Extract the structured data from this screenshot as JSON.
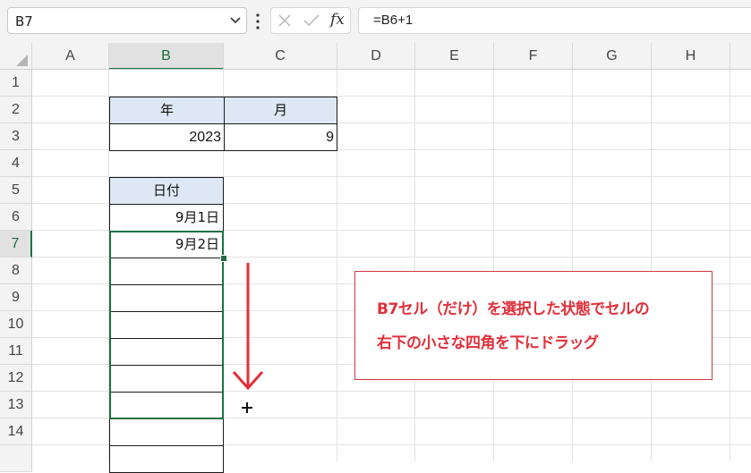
{
  "formula_bar": {
    "name_box": "B7",
    "fx_label": "fx",
    "formula": "=B6+1"
  },
  "columns": [
    "A",
    "B",
    "C",
    "D",
    "E",
    "F",
    "G",
    "H"
  ],
  "selected_column": "B",
  "rows": [
    "1",
    "2",
    "3",
    "4",
    "5",
    "6",
    "7",
    "8",
    "9",
    "10",
    "11",
    "12",
    "13",
    "14"
  ],
  "selected_row": "7",
  "cells": {
    "B2": "年",
    "C2": "月",
    "B3": "2023",
    "C3": "9",
    "B5": "日付",
    "B6": "9月1日",
    "B7": "9月2日"
  },
  "annotation": {
    "line1": "B7セル（だけ）を選択した状態でセルの",
    "line2": "右下の小さな四角を下にドラッグ"
  },
  "colors": {
    "selection": "#1f6e43",
    "header_fill": "#dde8f4",
    "annotation": "#e0303a"
  }
}
